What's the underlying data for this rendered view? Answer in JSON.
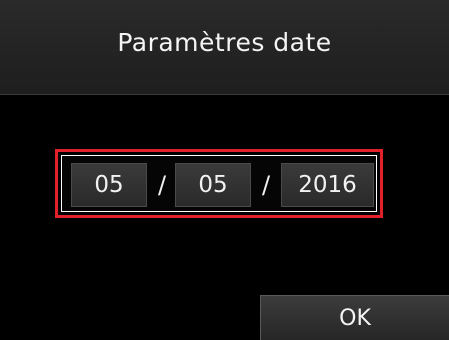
{
  "screen": {
    "title": "Paramètres date"
  },
  "date": {
    "day": "05",
    "month": "05",
    "year": "2016",
    "separator": "/"
  },
  "actions": {
    "ok_label": "OK"
  },
  "colors": {
    "background": "#000000",
    "selection_border": "#e0202a",
    "field_background": "#333333",
    "text": "#f2f2f2"
  }
}
